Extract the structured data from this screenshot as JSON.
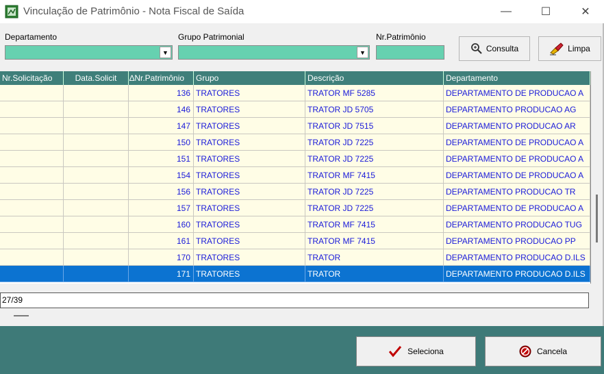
{
  "window": {
    "title": "Vinculação de Patrimônio - Nota Fiscal de Saída",
    "minimize": "—",
    "maximize": "☐",
    "close": "✕",
    "icon": "app-icon"
  },
  "filters": {
    "departamento_label": "Departamento",
    "departamento_value": "",
    "grupo_label": "Grupo Patrimonial",
    "grupo_value": "",
    "nrpat_label": "Nr.Patrimônio",
    "nrpat_value": ""
  },
  "toolbar": {
    "consulta_label": "Consulta",
    "limpa_label": "Limpa"
  },
  "grid": {
    "columns": [
      "Nr.Solicitação",
      "Data.Solicit",
      "Nr.Patrimônio",
      "Grupo",
      "Descrição",
      "Departamento"
    ],
    "sort_indicator": "∆",
    "rows": [
      {
        "nr_solicitacao": "",
        "data_solicit": "",
        "nr_patrimonio": "136",
        "grupo": "TRATORES",
        "descricao": "TRATOR MF 5285",
        "departamento": "DEPARTAMENTO DE PRODUCAO A"
      },
      {
        "nr_solicitacao": "",
        "data_solicit": "",
        "nr_patrimonio": "146",
        "grupo": "TRATORES",
        "descricao": "TRATOR JD 5705",
        "departamento": "DEPARTAMENTO PRODUCAO AG"
      },
      {
        "nr_solicitacao": "",
        "data_solicit": "",
        "nr_patrimonio": "147",
        "grupo": "TRATORES",
        "descricao": "TRATOR JD 7515",
        "departamento": "DEPARTAMENTO PRODUCAO AR"
      },
      {
        "nr_solicitacao": "",
        "data_solicit": "",
        "nr_patrimonio": "150",
        "grupo": "TRATORES",
        "descricao": "TRATOR JD 7225",
        "departamento": "DEPARTAMENTO DE PRODUCAO A"
      },
      {
        "nr_solicitacao": "",
        "data_solicit": "",
        "nr_patrimonio": "151",
        "grupo": "TRATORES",
        "descricao": "TRATOR JD 7225",
        "departamento": "DEPARTAMENTO DE PRODUCAO A"
      },
      {
        "nr_solicitacao": "",
        "data_solicit": "",
        "nr_patrimonio": "154",
        "grupo": "TRATORES",
        "descricao": "TRATOR MF 7415",
        "departamento": "DEPARTAMENTO DE PRODUCAO A"
      },
      {
        "nr_solicitacao": "",
        "data_solicit": "",
        "nr_patrimonio": "156",
        "grupo": "TRATORES",
        "descricao": "TRATOR JD 7225",
        "departamento": "DEPARTAMENTO PRODUCAO TR"
      },
      {
        "nr_solicitacao": "",
        "data_solicit": "",
        "nr_patrimonio": "157",
        "grupo": "TRATORES",
        "descricao": "TRATOR JD 7225",
        "departamento": "DEPARTAMENTO DE PRODUCAO A"
      },
      {
        "nr_solicitacao": "",
        "data_solicit": "",
        "nr_patrimonio": "160",
        "grupo": "TRATORES",
        "descricao": "TRATOR MF 7415",
        "departamento": "DEPARTAMENTO PRODUCAO TUG"
      },
      {
        "nr_solicitacao": "",
        "data_solicit": "",
        "nr_patrimonio": "161",
        "grupo": "TRATORES",
        "descricao": "TRATOR MF 7415",
        "departamento": "DEPARTAMENTO PRODUCAO PP"
      },
      {
        "nr_solicitacao": "",
        "data_solicit": "",
        "nr_patrimonio": "170",
        "grupo": "TRATORES",
        "descricao": "TRATOR",
        "departamento": "DEPARTAMENTO PRODUCAO D.ILS"
      },
      {
        "nr_solicitacao": "",
        "data_solicit": "",
        "nr_patrimonio": "171",
        "grupo": "TRATORES",
        "descricao": "TRATOR",
        "departamento": "DEPARTAMENTO PRODUCAO D.ILS",
        "selected": true
      }
    ]
  },
  "status": {
    "record_count": "27/39"
  },
  "actions": {
    "seleciona_label": "Seleciona",
    "cancela_label": "Cancela"
  },
  "colors": {
    "header": "#3f7f7a",
    "row_bg": "#fffde6",
    "row_text": "#1a1ad9",
    "selected": "#0c73d1",
    "combo": "#66d1b0",
    "footer": "#3e7a78"
  }
}
